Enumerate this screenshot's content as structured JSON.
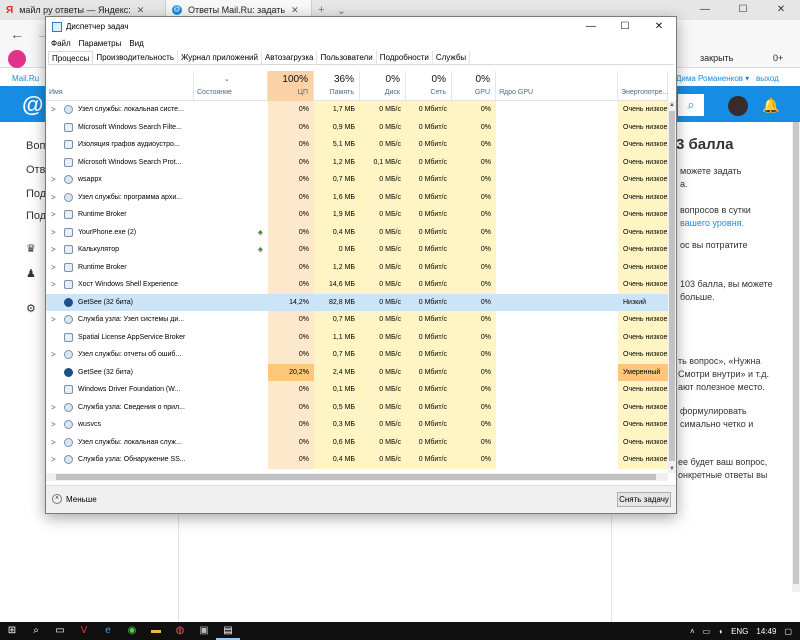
{
  "browser": {
    "tabs": [
      {
        "label": "майл ру ответы — Яндекс:",
        "favicon": "yandex-icon"
      },
      {
        "label": "Ответы Mail.Ru: задать",
        "favicon": "mailru-icon",
        "active": true
      }
    ],
    "site_label": "Mail.Ru",
    "close_link": "закрыть",
    "zoom_label": "0+",
    "user_link": "Дима Романенков ▾",
    "exit_link": "выход"
  },
  "page": {
    "left_nav": [
      "Воп",
      "Отв",
      "Под",
      "Под"
    ],
    "right_texts": [
      "3 балла",
      "можете задать",
      "а.",
      "вопросов в сутки",
      "вашего уровня.",
      "ос вы потратите",
      "103 балла, вы можете",
      "больше.",
      "ть вопрос», «Нужна",
      "Смотри внутри» и т.д.",
      "ают полезное место.",
      "формулировать",
      "симально четко и",
      "ее будет ваш вопрос,",
      "онкретные ответы вы"
    ]
  },
  "task_manager": {
    "title": "Диспетчер задач",
    "menu": [
      "Файл",
      "Параметры",
      "Вид"
    ],
    "tabs": [
      "Процессы",
      "Производительность",
      "Журнал приложений",
      "Автозагрузка",
      "Пользователи",
      "Подробности",
      "Службы"
    ],
    "columns": {
      "name": "Имя",
      "status": "Состояние",
      "cpu_pct": "100%",
      "cpu": "ЦП",
      "mem_pct": "36%",
      "mem": "Память",
      "disk_pct": "0%",
      "disk": "Диск",
      "net_pct": "0%",
      "net": "Сеть",
      "gpu_pct": "0%",
      "gpu": "GPU",
      "gpu_engine": "Ядро GPU",
      "power": "Энергопотре..."
    },
    "rows": [
      {
        "expand": ">",
        "icon": "gear-icon",
        "name": "Узел службы: локальная систе...",
        "cpu": "0%",
        "mem": "1,7 МБ",
        "disk": "0 МБ/с",
        "net": "0 Мбит/с",
        "gpu": "0%",
        "power": "Очень низкое"
      },
      {
        "expand": "",
        "icon": "search-icon",
        "name": "Microsoft Windows Search Filte...",
        "cpu": "0%",
        "mem": "0,9 МБ",
        "disk": "0 МБ/с",
        "net": "0 Мбит/с",
        "gpu": "0%",
        "power": "Очень низкое"
      },
      {
        "expand": "",
        "icon": "window-icon",
        "name": "Изоляция графов аудиоустро...",
        "cpu": "0%",
        "mem": "5,1 МБ",
        "disk": "0 МБ/с",
        "net": "0 Мбит/с",
        "gpu": "0%",
        "power": "Очень низкое"
      },
      {
        "expand": "",
        "icon": "search-icon",
        "name": "Microsoft Windows Search Prot...",
        "cpu": "0%",
        "mem": "1,2 МБ",
        "disk": "0,1 МБ/с",
        "net": "0 Мбит/с",
        "gpu": "0%",
        "power": "Очень низкое"
      },
      {
        "expand": ">",
        "icon": "gear-icon",
        "name": "wsappx",
        "cpu": "0%",
        "mem": "0,7 МБ",
        "disk": "0 МБ/с",
        "net": "0 Мбит/с",
        "gpu": "0%",
        "power": "Очень низкое"
      },
      {
        "expand": ">",
        "icon": "gear-icon",
        "name": "Узел службы: программа архи...",
        "cpu": "0%",
        "mem": "1,6 МБ",
        "disk": "0 МБ/с",
        "net": "0 Мбит/с",
        "gpu": "0%",
        "power": "Очень низкое"
      },
      {
        "expand": ">",
        "icon": "window-icon",
        "name": "Runtime Broker",
        "cpu": "0%",
        "mem": "1,9 МБ",
        "disk": "0 МБ/с",
        "net": "0 Мбит/с",
        "gpu": "0%",
        "power": "Очень низкое"
      },
      {
        "expand": ">",
        "icon": "phone-icon",
        "name": "YourPhone.exe (2)",
        "suspended": true,
        "cpu": "0%",
        "mem": "0,4 МБ",
        "disk": "0 МБ/с",
        "net": "0 Мбит/с",
        "gpu": "0%",
        "power": "Очень низкое"
      },
      {
        "expand": ">",
        "icon": "calculator-icon",
        "name": "Калькулятор",
        "suspended": true,
        "cpu": "0%",
        "mem": "0 МБ",
        "disk": "0 МБ/с",
        "net": "0 Мбит/с",
        "gpu": "0%",
        "power": "Очень низкое"
      },
      {
        "expand": ">",
        "icon": "window-icon",
        "name": "Runtime Broker",
        "cpu": "0%",
        "mem": "1,2 МБ",
        "disk": "0 МБ/с",
        "net": "0 Мбит/с",
        "gpu": "0%",
        "power": "Очень низкое"
      },
      {
        "expand": ">",
        "icon": "window-icon",
        "name": "Хост Windows Shell Experience",
        "cpu": "0%",
        "mem": "14,6 МБ",
        "disk": "0 МБ/с",
        "net": "0 Мбит/с",
        "gpu": "0%",
        "power": "Очень низкое"
      },
      {
        "expand": "",
        "icon": "getsee-icon",
        "name": "GetSee (32 бита)",
        "selected": true,
        "cpu": "14,2%",
        "mem": "82,8 МБ",
        "disk": "0 МБ/с",
        "net": "0 Мбит/с",
        "gpu": "0%",
        "power": "Низкий"
      },
      {
        "expand": ">",
        "icon": "gear-icon",
        "name": "Служба узла: Узел системы ди...",
        "cpu": "0%",
        "mem": "0,7 МБ",
        "disk": "0 МБ/с",
        "net": "0 Мбит/с",
        "gpu": "0%",
        "power": "Очень низкое"
      },
      {
        "expand": "",
        "icon": "window-icon",
        "name": "Spatial License AppService Broker",
        "cpu": "0%",
        "mem": "1,1 МБ",
        "disk": "0 МБ/с",
        "net": "0 Мбит/с",
        "gpu": "0%",
        "power": "Очень низкое"
      },
      {
        "expand": ">",
        "icon": "gear-icon",
        "name": "Узел службы: отчеты об ошиб...",
        "cpu": "0%",
        "mem": "0,7 МБ",
        "disk": "0 МБ/с",
        "net": "0 Мбит/с",
        "gpu": "0%",
        "power": "Очень низкое"
      },
      {
        "expand": "",
        "icon": "getsee-icon",
        "name": "GetSee (32 бита)",
        "cpu_high": true,
        "cpu": "20,2%",
        "mem": "2,4 МБ",
        "disk": "0 МБ/с",
        "net": "0 Мбит/с",
        "gpu": "0%",
        "power": "Умеренный",
        "power_mod": true
      },
      {
        "expand": "",
        "icon": "window-icon",
        "name": "Windows Driver Foundation (W...",
        "cpu": "0%",
        "mem": "0,1 МБ",
        "disk": "0 МБ/с",
        "net": "0 Мбит/с",
        "gpu": "0%",
        "power": "Очень низкое"
      },
      {
        "expand": ">",
        "icon": "gear-icon",
        "name": "Служба узла: Сведения о прил...",
        "cpu": "0%",
        "mem": "0,5 МБ",
        "disk": "0 МБ/с",
        "net": "0 Мбит/с",
        "gpu": "0%",
        "power": "Очень низкое"
      },
      {
        "expand": ">",
        "icon": "gear-icon",
        "name": "wusvcs",
        "cpu": "0%",
        "mem": "0,3 МБ",
        "disk": "0 МБ/с",
        "net": "0 Мбит/с",
        "gpu": "0%",
        "power": "Очень низкое"
      },
      {
        "expand": ">",
        "icon": "gear-icon",
        "name": "Узел службы: локальная служ...",
        "cpu": "0%",
        "mem": "0,6 МБ",
        "disk": "0 МБ/с",
        "net": "0 Мбит/с",
        "gpu": "0%",
        "power": "Очень низкое"
      },
      {
        "expand": ">",
        "icon": "gear-icon",
        "name": "Служба узла: Обнаружение SS...",
        "cpu": "0%",
        "mem": "0,4 МБ",
        "disk": "0 МБ/с",
        "net": "0 Мбит/с",
        "gpu": "0%",
        "power": "Очень низкое"
      }
    ],
    "fewer_label": "Меньше",
    "end_task_label": "Снять задачу"
  },
  "taskbar": {
    "lang": "ENG",
    "time": "14:49"
  }
}
